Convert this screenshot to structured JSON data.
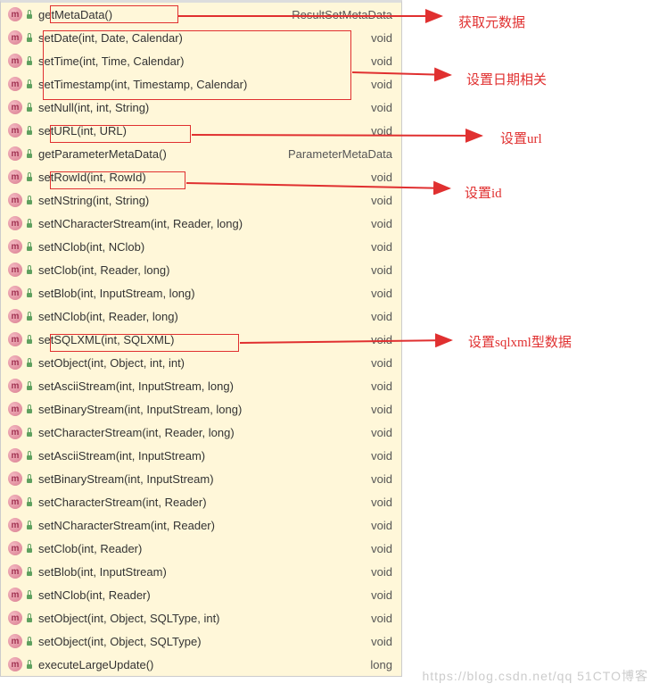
{
  "methods": [
    {
      "name": "getMetaData()",
      "ret": "ResultSetMetaData"
    },
    {
      "name": "setDate(int, Date, Calendar)",
      "ret": "void"
    },
    {
      "name": "setTime(int, Time, Calendar)",
      "ret": "void"
    },
    {
      "name": "setTimestamp(int, Timestamp, Calendar)",
      "ret": "void"
    },
    {
      "name": "setNull(int, int, String)",
      "ret": "void"
    },
    {
      "name": "setURL(int, URL)",
      "ret": "void"
    },
    {
      "name": "getParameterMetaData()",
      "ret": "ParameterMetaData"
    },
    {
      "name": "setRowId(int, RowId)",
      "ret": "void"
    },
    {
      "name": "setNString(int, String)",
      "ret": "void"
    },
    {
      "name": "setNCharacterStream(int, Reader, long)",
      "ret": "void"
    },
    {
      "name": "setNClob(int, NClob)",
      "ret": "void"
    },
    {
      "name": "setClob(int, Reader, long)",
      "ret": "void"
    },
    {
      "name": "setBlob(int, InputStream, long)",
      "ret": "void"
    },
    {
      "name": "setNClob(int, Reader, long)",
      "ret": "void"
    },
    {
      "name": "setSQLXML(int, SQLXML)",
      "ret": "void"
    },
    {
      "name": "setObject(int, Object, int, int)",
      "ret": "void"
    },
    {
      "name": "setAsciiStream(int, InputStream, long)",
      "ret": "void"
    },
    {
      "name": "setBinaryStream(int, InputStream, long)",
      "ret": "void"
    },
    {
      "name": "setCharacterStream(int, Reader, long)",
      "ret": "void"
    },
    {
      "name": "setAsciiStream(int, InputStream)",
      "ret": "void"
    },
    {
      "name": "setBinaryStream(int, InputStream)",
      "ret": "void"
    },
    {
      "name": "setCharacterStream(int, Reader)",
      "ret": "void"
    },
    {
      "name": "setNCharacterStream(int, Reader)",
      "ret": "void"
    },
    {
      "name": "setClob(int, Reader)",
      "ret": "void"
    },
    {
      "name": "setBlob(int, InputStream)",
      "ret": "void"
    },
    {
      "name": "setNClob(int, Reader)",
      "ret": "void"
    },
    {
      "name": "setObject(int, Object, SQLType, int)",
      "ret": "void"
    },
    {
      "name": "setObject(int, Object, SQLType)",
      "ret": "void"
    },
    {
      "name": "executeLargeUpdate()",
      "ret": "long"
    }
  ],
  "annotations": {
    "a0": "获取元数据",
    "a1": "设置日期相关",
    "a2": "设置url",
    "a3": "设置id",
    "a4": "设置sqlxml型数据"
  },
  "icon_m_char": "m",
  "watermark": "https://blog.csdn.net/qq 51CTO博客"
}
